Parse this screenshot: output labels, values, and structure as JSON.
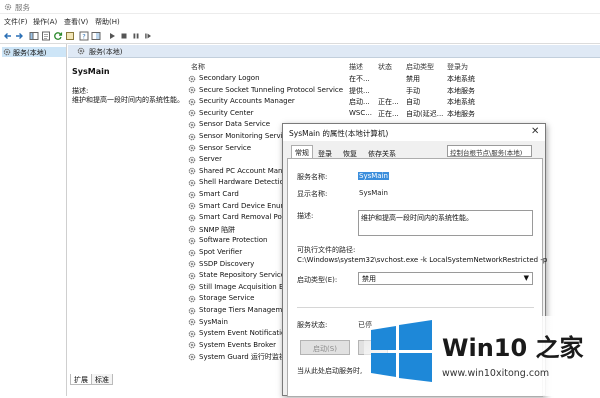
{
  "window": {
    "title": "服务"
  },
  "menu": [
    "文件(F)",
    "操作(A)",
    "查看(V)",
    "帮助(H)"
  ],
  "tree": {
    "root": "服务(本地)"
  },
  "pane": {
    "header": "服务(本地)"
  },
  "description_panel": {
    "service_name": "SysMain",
    "label": "描述:",
    "text": "维护和提高一段时间内的系统性能。"
  },
  "list": {
    "columns": [
      "名称",
      "描述",
      "状态",
      "启动类型",
      "登录为"
    ],
    "rows": [
      {
        "name": "Secondary Logon",
        "desc": "在不...",
        "status": "",
        "start": "禁用",
        "logon": "本地系统"
      },
      {
        "name": "Secure Socket Tunneling Protocol Service",
        "desc": "提供...",
        "status": "",
        "start": "手动",
        "logon": "本地服务"
      },
      {
        "name": "Security Accounts Manager",
        "desc": "启动...",
        "status": "正在...",
        "start": "自动",
        "logon": "本地系统"
      },
      {
        "name": "Security Center",
        "desc": "WSC...",
        "status": "正在...",
        "start": "自动(延迟...",
        "logon": "本地服务"
      },
      {
        "name": "Sensor Data Service",
        "desc": "",
        "status": "",
        "start": "",
        "logon": ""
      },
      {
        "name": "Sensor Monitoring Service",
        "desc": "",
        "status": "",
        "start": "",
        "logon": ""
      },
      {
        "name": "Sensor Service",
        "desc": "",
        "status": "",
        "start": "",
        "logon": ""
      },
      {
        "name": "Server",
        "desc": "",
        "status": "",
        "start": "",
        "logon": ""
      },
      {
        "name": "Shared PC Account Manag",
        "desc": "",
        "status": "",
        "start": "",
        "logon": ""
      },
      {
        "name": "Shell Hardware Detection",
        "desc": "",
        "status": "",
        "start": "",
        "logon": ""
      },
      {
        "name": "Smart Card",
        "desc": "",
        "status": "",
        "start": "",
        "logon": ""
      },
      {
        "name": "Smart Card Device Enume",
        "desc": "",
        "status": "",
        "start": "",
        "logon": ""
      },
      {
        "name": "Smart Card Removal Polic",
        "desc": "",
        "status": "",
        "start": "",
        "logon": ""
      },
      {
        "name": "SNMP 陷阱",
        "desc": "",
        "status": "",
        "start": "",
        "logon": ""
      },
      {
        "name": "Software Protection",
        "desc": "",
        "status": "",
        "start": "",
        "logon": ""
      },
      {
        "name": "Spot Verifier",
        "desc": "",
        "status": "",
        "start": "",
        "logon": ""
      },
      {
        "name": "SSDP Discovery",
        "desc": "",
        "status": "",
        "start": "",
        "logon": ""
      },
      {
        "name": "State Repository Service",
        "desc": "",
        "status": "",
        "start": "",
        "logon": ""
      },
      {
        "name": "Still Image Acquisition Eve",
        "desc": "",
        "status": "",
        "start": "",
        "logon": ""
      },
      {
        "name": "Storage Service",
        "desc": "",
        "status": "",
        "start": "",
        "logon": ""
      },
      {
        "name": "Storage Tiers Management",
        "desc": "",
        "status": "",
        "start": "",
        "logon": ""
      },
      {
        "name": "SysMain",
        "desc": "",
        "status": "",
        "start": "",
        "logon": ""
      },
      {
        "name": "System Event Notification",
        "desc": "",
        "status": "",
        "start": "",
        "logon": ""
      },
      {
        "name": "System Events Broker",
        "desc": "",
        "status": "",
        "start": "",
        "logon": ""
      },
      {
        "name": "System Guard 运行时监视器",
        "desc": "",
        "status": "",
        "start": "",
        "logon": ""
      }
    ]
  },
  "bottom_tabs": [
    "扩展",
    "标准"
  ],
  "dialog": {
    "title": "SysMain 的属性(本地计算机)",
    "close": "✕",
    "tabs": [
      "常规",
      "登录",
      "恢复",
      "依存关系"
    ],
    "tooltip": "控制台根节点\\服务(本地)",
    "service_name_label": "服务名称:",
    "service_name": "SysMain",
    "display_name_label": "显示名称:",
    "display_name": "SysMain",
    "desc_label": "描述:",
    "desc": "维护和提高一段时间内的系统性能。",
    "path_label": "可执行文件的路径:",
    "path": "C:\\Windows\\system32\\svchost.exe -k LocalSystemNetworkRestricted -p",
    "startup_label": "启动类型(E):",
    "startup_value": "禁用",
    "status_label": "服务状态:",
    "status_value": "已停",
    "start_button": "启动(S)",
    "start_params_label": "当从此处启动服务时,"
  },
  "watermark": {
    "brand": "Win10 之家",
    "url": "www.win10xitong.com"
  },
  "colors": {
    "selection": "#3b8edc",
    "tree_highlight": "#cde5f7",
    "logo_blue": "#1e88d8"
  }
}
